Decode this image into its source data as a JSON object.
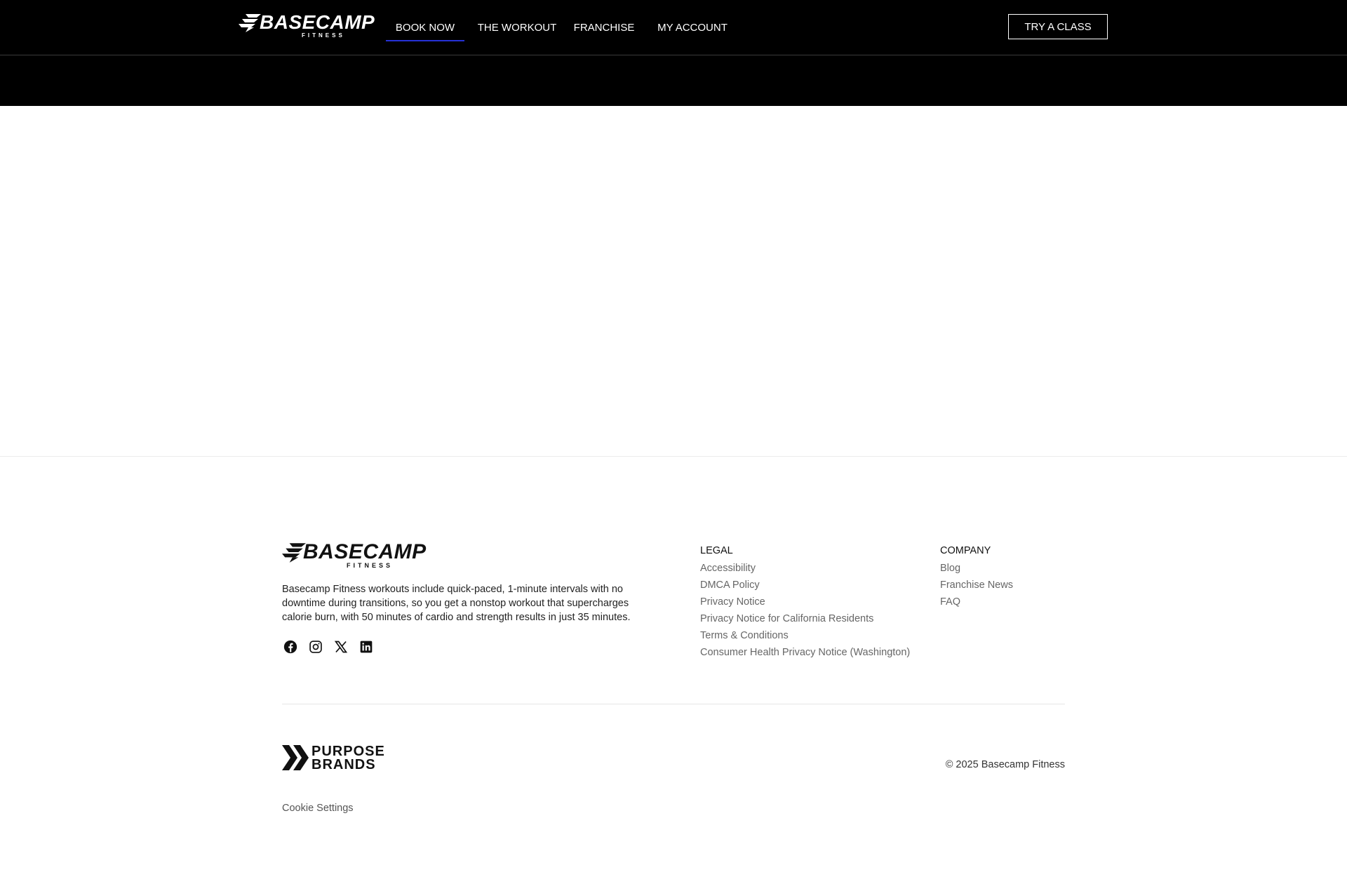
{
  "brand": {
    "logo_word": "BASECAMP",
    "logo_sub": "FITNESS"
  },
  "nav": {
    "items": [
      {
        "label": "BOOK NOW",
        "active": true
      },
      {
        "label": "THE WORKOUT"
      },
      {
        "label": "FRANCHISE"
      },
      {
        "label": "MY ACCOUNT"
      }
    ],
    "cta_label": "TRY A CLASS",
    "active_underline_color": "#2531d6"
  },
  "footer": {
    "description": "Basecamp Fitness workouts include quick-paced, 1-minute intervals with no downtime during transitions, so you get a nonstop workout that supercharges calorie burn, with 50 minutes of cardio and strength results in just 35 minutes.",
    "socials": [
      {
        "icon": "facebook-icon"
      },
      {
        "icon": "instagram-icon"
      },
      {
        "icon": "x-icon"
      },
      {
        "icon": "linkedin-icon"
      }
    ],
    "legal": {
      "heading": "LEGAL",
      "links": [
        "Accessibility",
        "DMCA Policy",
        "Privacy Notice",
        "Privacy Notice for California Residents",
        "Terms & Conditions",
        "Consumer Health Privacy Notice (Washington)"
      ]
    },
    "company": {
      "heading": "COMPANY",
      "links": [
        "Blog",
        "Franchise News",
        "FAQ"
      ]
    },
    "parent_brand_line1": "PURPOSE",
    "parent_brand_line2": "BRANDS",
    "copyright": "© 2025 Basecamp Fitness",
    "cookie_settings": "Cookie Settings"
  }
}
